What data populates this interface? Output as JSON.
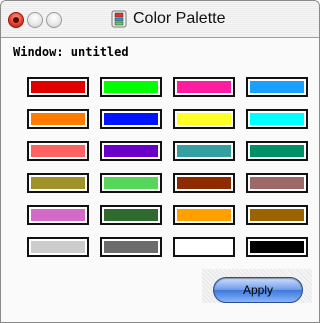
{
  "window": {
    "title": "Color Palette",
    "label": "Window: untitled"
  },
  "icons": {
    "close": "close-icon",
    "minimize": "minimize-icon",
    "zoom": "zoom-icon",
    "app": "palette-app-icon"
  },
  "palette": {
    "rows": [
      [
        "#e00000",
        "#00ff00",
        "#ff1ca0",
        "#1aa0ff"
      ],
      [
        "#ff7a00",
        "#0014ff",
        "#ffff28",
        "#00ffff"
      ],
      [
        "#ff6262",
        "#6a00c8",
        "#34a0a0",
        "#009068"
      ],
      [
        "#9e9228",
        "#58d65c",
        "#8e2a00",
        "#9c6868"
      ],
      [
        "#d46ac8",
        "#2f6a2e",
        "#ffa000",
        "#9c6400"
      ],
      [
        "#cccccc",
        "#6c6c6c",
        "#ffffff",
        "#000000"
      ]
    ]
  },
  "buttons": {
    "apply": "Apply"
  }
}
